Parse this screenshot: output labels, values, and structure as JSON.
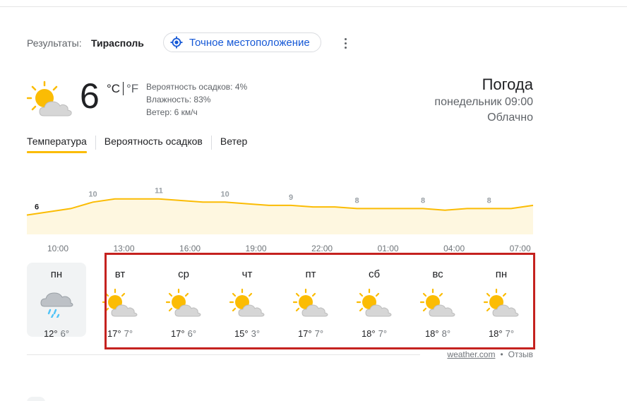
{
  "header": {
    "results_label": "Результаты:",
    "city": "Тирасполь",
    "location_button": "Точное местоположение",
    "location_icon": "location-crosshair-icon",
    "more_icon": "more-vert-icon"
  },
  "current": {
    "icon": "partly-cloudy-icon",
    "temperature": "6",
    "unit_c": "°C",
    "unit_f": "°F",
    "precipitation": "Вероятность осадков: 4%",
    "humidity": "Влажность: 83%",
    "wind": "Ветер: 6 км/ч"
  },
  "summary": {
    "title": "Погода",
    "time": "понедельник 09:00",
    "condition": "Облачно"
  },
  "tabs": [
    {
      "label": "Температура",
      "active": true
    },
    {
      "label": "Вероятность осадков",
      "active": false
    },
    {
      "label": "Ветер",
      "active": false
    }
  ],
  "chart_data": {
    "type": "area",
    "x": [
      "10:00",
      "11:00",
      "12:00",
      "13:00",
      "14:00",
      "15:00",
      "16:00",
      "17:00",
      "18:00",
      "19:00",
      "20:00",
      "21:00",
      "22:00",
      "23:00",
      "00:00",
      "01:00",
      "02:00",
      "03:00",
      "04:00",
      "05:00",
      "06:00",
      "07:00",
      "08:00",
      "09:00"
    ],
    "y": [
      6,
      7,
      8,
      10,
      11,
      11,
      11,
      10.5,
      10,
      10,
      9.5,
      9,
      9,
      8.5,
      8.5,
      8,
      8,
      8,
      8,
      7.5,
      8,
      8,
      8,
      9
    ],
    "point_labels": [
      {
        "x": "10:00",
        "label": "6"
      },
      {
        "x": "13:00",
        "label": "10"
      },
      {
        "x": "16:00",
        "label": "11"
      },
      {
        "x": "19:00",
        "label": "10"
      },
      {
        "x": "22:00",
        "label": "9"
      },
      {
        "x": "01:00",
        "label": "8"
      },
      {
        "x": "04:00",
        "label": "8"
      },
      {
        "x": "07:00",
        "label": "8"
      }
    ],
    "tick_labels": [
      "10:00",
      "13:00",
      "16:00",
      "19:00",
      "22:00",
      "01:00",
      "04:00",
      "07:00"
    ],
    "line_color": "#fbbc04",
    "fill_color": "#fef7e0"
  },
  "days": [
    {
      "name": "пн",
      "icon": "rain-cloud-icon",
      "hi": "12°",
      "lo": "6°",
      "active": true
    },
    {
      "name": "вт",
      "icon": "partly-cloudy-icon",
      "hi": "17°",
      "lo": "7°",
      "active": false
    },
    {
      "name": "ср",
      "icon": "partly-cloudy-icon",
      "hi": "17°",
      "lo": "6°",
      "active": false
    },
    {
      "name": "чт",
      "icon": "partly-cloudy-icon",
      "hi": "15°",
      "lo": "3°",
      "active": false
    },
    {
      "name": "пт",
      "icon": "partly-cloudy-icon",
      "hi": "17°",
      "lo": "7°",
      "active": false
    },
    {
      "name": "сб",
      "icon": "partly-cloudy-icon",
      "hi": "18°",
      "lo": "7°",
      "active": false
    },
    {
      "name": "вс",
      "icon": "partly-cloudy-icon",
      "hi": "18°",
      "lo": "8°",
      "active": false
    },
    {
      "name": "пн",
      "icon": "partly-cloudy-icon",
      "hi": "18°",
      "lo": "7°",
      "active": false
    }
  ],
  "footer": {
    "source": "weather.com",
    "separator": "•",
    "feedback": "Отзыв"
  },
  "colors": {
    "highlight_border": "#c5221f",
    "accent": "#fbbc04",
    "link": "#1558d6"
  }
}
